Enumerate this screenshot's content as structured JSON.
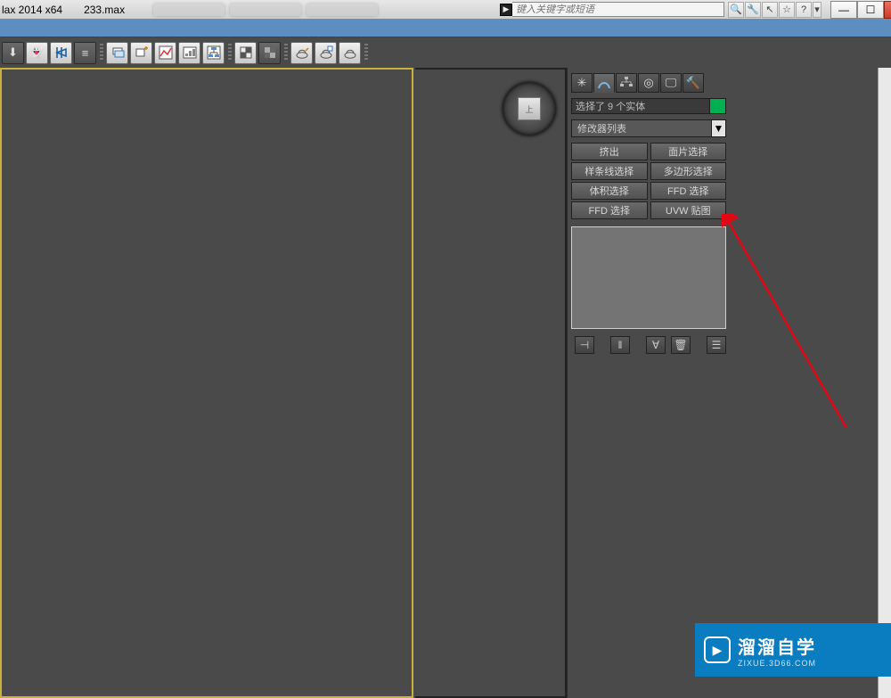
{
  "title": {
    "app": "lax 2014 x64",
    "file": "233.max"
  },
  "infobar": {
    "input_placeholder": "键入关键字或短语"
  },
  "status": {
    "selection": "选择了 9 个实体",
    "modifier_list": "修改器列表"
  },
  "presets": {
    "r0c0": "挤出",
    "r0c1": "面片选择",
    "r1c0": "样条线选择",
    "r1c1": "多边形选择",
    "r2c0": "体积选择",
    "r2c1": "FFD 选择",
    "r3c0": "FFD 选择",
    "r3c1": "UVW 贴图"
  },
  "watermark": {
    "big": "溜溜自学",
    "small": "ZIXUE.3D66.COM"
  },
  "viewcube": {
    "face": "上"
  },
  "color_swatch": "#00b050"
}
